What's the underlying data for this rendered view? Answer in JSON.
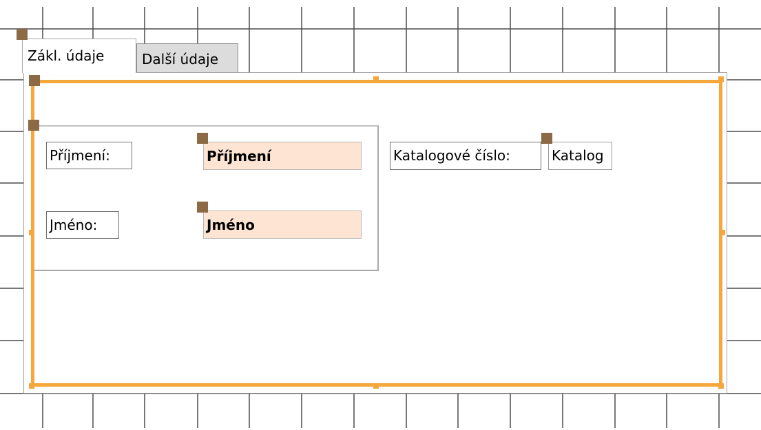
{
  "tabs": {
    "active_label": "Zákl. údaje",
    "inactive_label": "Další údaje"
  },
  "controls": {
    "prijmeni_label": "Příjmení:",
    "prijmeni_field": "Příjmení",
    "jmeno_label": "Jméno:",
    "jmeno_field": "Jméno",
    "katalog_label": "Katalogové číslo:",
    "katalog_field": "Katalog"
  },
  "colors": {
    "selection": "#f5a73b",
    "handle": "#8b6a45",
    "bound_field_bg": "#fde4d3",
    "inactive_tab_bg": "#dcdcdc"
  }
}
